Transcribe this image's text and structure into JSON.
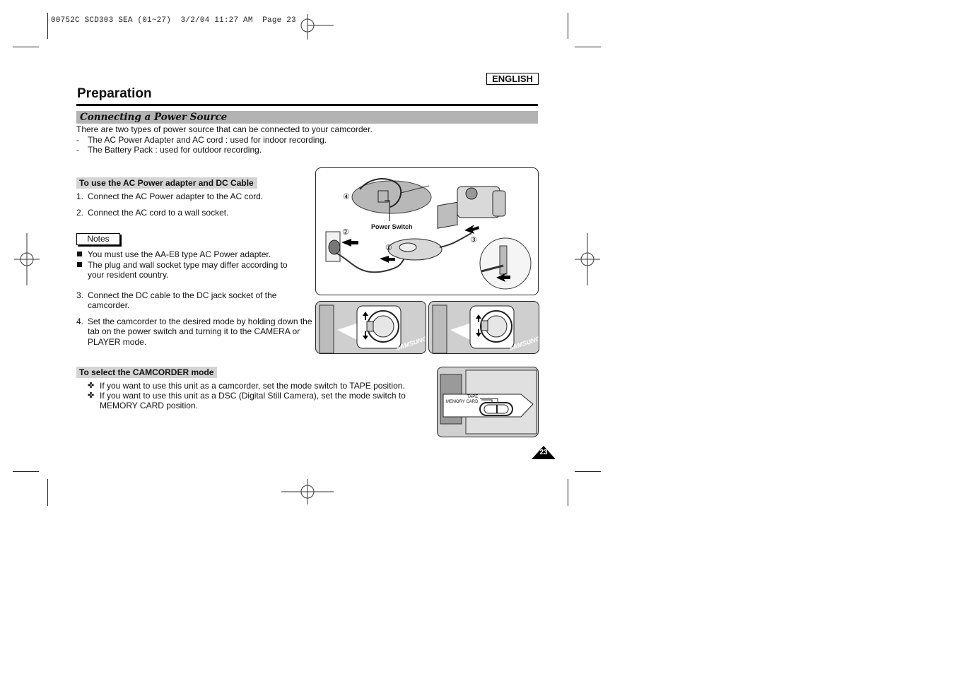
{
  "slug_line": "00752C SCD303 SEA (01~27)  3/2/04 11:27 AM  Page 23",
  "language_label": "ENGLISH",
  "page_title": "Preparation",
  "section_title": "Connecting a Power Source",
  "intro": {
    "text": "There are two types of power source that can be connected to your camcorder.",
    "items": [
      {
        "marker": "-",
        "text": "The AC Power Adapter and AC cord : used for indoor recording."
      },
      {
        "marker": "-",
        "text": "The Battery Pack : used for outdoor recording."
      }
    ]
  },
  "ac_section": {
    "heading": "To use the AC Power adapter and DC Cable",
    "steps": [
      {
        "num": "1.",
        "lines": [
          "Connect the AC Power adapter to the AC cord."
        ]
      },
      {
        "num": "2.",
        "lines": [
          "Connect the AC cord to a wall socket."
        ]
      },
      {
        "num": "3.",
        "lines": [
          "Connect the DC cable to the DC jack socket of the",
          "camcorder."
        ]
      },
      {
        "num": "4.",
        "lines": [
          "Set the camcorder to the desired mode by holding down the",
          "tab on the power switch and turning it to the CAMERA or",
          "PLAYER mode."
        ]
      }
    ],
    "notes_label": "Notes",
    "notes": [
      {
        "lines": [
          "You must use the AA-E8 type AC Power adapter."
        ]
      },
      {
        "lines": [
          "The plug and wall socket type may differ according to",
          "your resident country."
        ]
      }
    ]
  },
  "mode_section": {
    "heading": "To select the CAMCORDER mode",
    "bullet_glyph": "✤",
    "items": [
      {
        "lines": [
          "If you want to use this unit as a camcorder, set the mode switch to TAPE position."
        ]
      },
      {
        "lines": [
          "If you want to use this unit as a DSC (Digital Still Camera), set the mode switch to",
          "MEMORY CARD position."
        ]
      }
    ]
  },
  "figures": {
    "connection": {
      "power_switch_label": "Power Switch",
      "callouts": [
        "①",
        "②",
        "③",
        "④"
      ]
    },
    "dial_left": {
      "brand": "SAMSUNG"
    },
    "dial_right": {
      "brand": "SAMSUNG"
    },
    "mode_switch": {
      "tape_label": "TAPE",
      "memory_label": "MEMORY CARD"
    }
  },
  "page_number": "23"
}
